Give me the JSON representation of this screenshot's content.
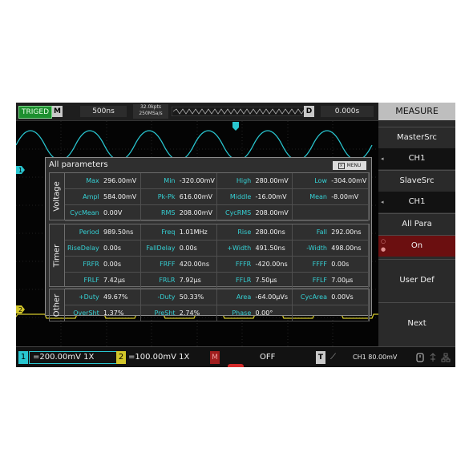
{
  "topbar": {
    "status": "TRIGED",
    "mode": "M",
    "timebase": "500ns",
    "sample_line1": "32.0kpts",
    "sample_line2": "250MSa/s",
    "delay_marker": "D",
    "delay_value": "0.000s"
  },
  "markers": {
    "ch1": "1",
    "ch2": "2"
  },
  "dialog": {
    "title": "All parameters",
    "menu_label": "MENU",
    "close_glyph": "×",
    "sections": [
      {
        "label": "Voltage",
        "cells": [
          {
            "name": "Max",
            "value": "296.00mV"
          },
          {
            "name": "Min",
            "value": "-320.00mV"
          },
          {
            "name": "High",
            "value": "280.00mV"
          },
          {
            "name": "Low",
            "value": "-304.00mV"
          },
          {
            "name": "Ampl",
            "value": "584.00mV"
          },
          {
            "name": "Pk-Pk",
            "value": "616.00mV"
          },
          {
            "name": "Middle",
            "value": "-16.00mV"
          },
          {
            "name": "Mean",
            "value": "-8.00mV"
          },
          {
            "name": "CycMean",
            "value": "0.00V"
          },
          {
            "name": "RMS",
            "value": "208.00mV"
          },
          {
            "name": "CycRMS",
            "value": "208.00mV"
          },
          {
            "name": "",
            "value": ""
          }
        ]
      },
      {
        "label": "Timer",
        "cells": [
          {
            "name": "Period",
            "value": "989.50ns"
          },
          {
            "name": "Freq",
            "value": "1.01MHz"
          },
          {
            "name": "Rise",
            "value": "280.00ns"
          },
          {
            "name": "Fall",
            "value": "292.00ns"
          },
          {
            "name": "RiseDelay",
            "value": "0.00s"
          },
          {
            "name": "FallDelay",
            "value": "0.00s"
          },
          {
            "name": "+Width",
            "value": "491.50ns"
          },
          {
            "name": "-Width",
            "value": "498.00ns"
          },
          {
            "name": "FRFR",
            "value": "0.00s"
          },
          {
            "name": "FRFF",
            "value": "420.00ns"
          },
          {
            "name": "FFFR",
            "value": "-420.00ns"
          },
          {
            "name": "FFFF",
            "value": "0.00s"
          },
          {
            "name": "FRLF",
            "value": "7.42µs"
          },
          {
            "name": "FRLR",
            "value": "7.92µs"
          },
          {
            "name": "FFLR",
            "value": "7.50µs"
          },
          {
            "name": "FFLF",
            "value": "7.00µs"
          }
        ]
      },
      {
        "label": "Other",
        "cells": [
          {
            "name": "+Duty",
            "value": "49.67%"
          },
          {
            "name": "-Duty",
            "value": "50.33%"
          },
          {
            "name": "Area",
            "value": "-64.00µVs"
          },
          {
            "name": "CycArea",
            "value": "0.00Vs"
          },
          {
            "name": "OverSht",
            "value": "1.37%"
          },
          {
            "name": "PreSht",
            "value": "2.74%"
          },
          {
            "name": "Phase",
            "value": "0.00°"
          },
          {
            "name": "",
            "value": ""
          }
        ]
      }
    ]
  },
  "menu": {
    "title": "MEASURE",
    "master_label": "MasterSrc",
    "master_value": "CH1",
    "slave_label": "SlaveSrc",
    "slave_value": "CH1",
    "allpara_label": "All Para",
    "allpara_value": "On",
    "user_def_label": "User Def",
    "next_label": "Next"
  },
  "bottom": {
    "ch1_tag": "1",
    "ch1_value": "=200.00mV 1X",
    "ch2_tag": "2",
    "ch2_value": "=100.00mV 1X",
    "math_tag": "M",
    "math_value": "OFF",
    "trig_tag": "T",
    "trig_edge": "⟋",
    "trig_value": "CH1 80.00mV"
  },
  "colors": {
    "ch1": "#29c6d0",
    "ch2": "#d2c62a",
    "selected": "#6b0f10",
    "label": "#35d0d4"
  }
}
